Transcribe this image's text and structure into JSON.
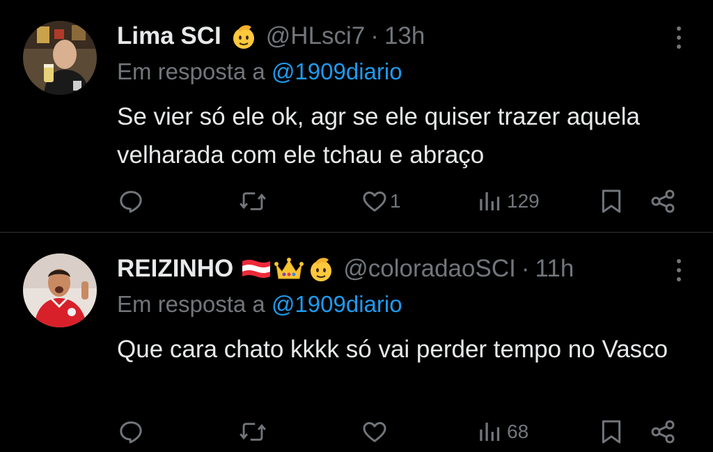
{
  "colors": {
    "background": "#000000",
    "text": "#e7e9ea",
    "muted": "#71767b",
    "link": "#1d9bf0",
    "divider": "#2f3336"
  },
  "tweets": [
    {
      "display_name": "Lima SCI",
      "badges": [
        "saluting-face-emoji"
      ],
      "handle": "@HLsci7",
      "separator": "·",
      "time": "13h",
      "reply_prefix": "Em resposta a",
      "reply_to": "@1909diario",
      "text": "Se vier só ele ok, agr se ele quiser trazer aquela velharada com ele tchau e abraço",
      "replies": "",
      "reposts": "",
      "likes": "1",
      "views": "129"
    },
    {
      "display_name": "REIZINHO",
      "badges": [
        "austria-flag-emoji",
        "crown-emoji",
        "saluting-face-emoji"
      ],
      "handle": "@coloradaoSCI",
      "separator": "·",
      "time": "11h",
      "reply_prefix": "Em resposta a",
      "reply_to": "@1909diario",
      "text": "Que cara chato kkkk só vai perder tempo no Vasco",
      "replies": "",
      "reposts": "",
      "likes": "",
      "views": "68"
    }
  ]
}
